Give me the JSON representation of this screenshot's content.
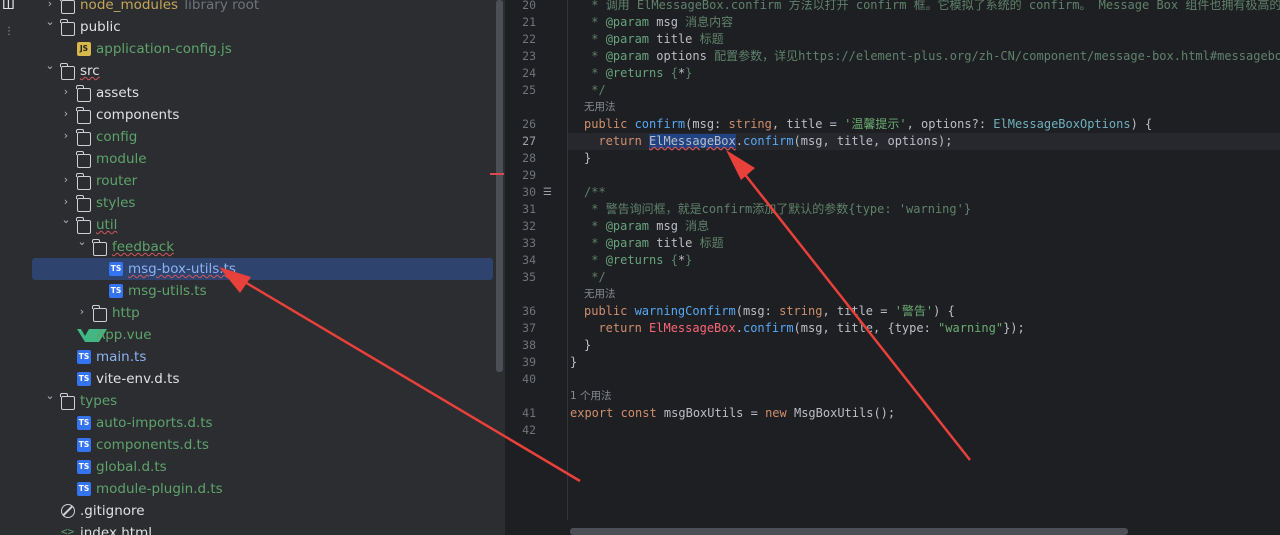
{
  "tree": [
    {
      "label": "node_modules",
      "extra": "library root",
      "kind": "folder",
      "depth": 0,
      "expanded": false,
      "style": "olive"
    },
    {
      "label": "public",
      "kind": "folder",
      "depth": 0,
      "expanded": true,
      "style": "normal"
    },
    {
      "label": "application-config.js",
      "kind": "js",
      "depth": 1,
      "style": "green"
    },
    {
      "label": "src",
      "kind": "folder",
      "depth": 0,
      "expanded": true,
      "style": "normal",
      "wavy": true
    },
    {
      "label": "assets",
      "kind": "folder",
      "depth": 1,
      "expanded": false,
      "style": "normal"
    },
    {
      "label": "components",
      "kind": "folder",
      "depth": 1,
      "expanded": false,
      "style": "normal"
    },
    {
      "label": "config",
      "kind": "folder",
      "depth": 1,
      "expanded": false,
      "style": "green"
    },
    {
      "label": "module",
      "kind": "folder",
      "depth": 1,
      "style": "green"
    },
    {
      "label": "router",
      "kind": "folder",
      "depth": 1,
      "expanded": false,
      "style": "green"
    },
    {
      "label": "styles",
      "kind": "folder",
      "depth": 1,
      "expanded": false,
      "style": "green"
    },
    {
      "label": "util",
      "kind": "folder",
      "depth": 1,
      "expanded": true,
      "style": "green",
      "wavy": true
    },
    {
      "label": "feedback",
      "kind": "folder",
      "depth": 2,
      "expanded": true,
      "style": "green",
      "wavy": true
    },
    {
      "label": "msg-box-utils.ts",
      "kind": "ts",
      "depth": 3,
      "style": "blue",
      "selected": true,
      "wavy": true
    },
    {
      "label": "msg-utils.ts",
      "kind": "ts",
      "depth": 3,
      "style": "green"
    },
    {
      "label": "http",
      "kind": "folder",
      "depth": 2,
      "expanded": false,
      "style": "green"
    },
    {
      "label": "App.vue",
      "kind": "vue",
      "depth": 1,
      "style": "green"
    },
    {
      "label": "main.ts",
      "kind": "ts",
      "depth": 1,
      "style": "blue"
    },
    {
      "label": "vite-env.d.ts",
      "kind": "ts",
      "depth": 1,
      "style": "normal"
    },
    {
      "label": "types",
      "kind": "folder",
      "depth": 0,
      "expanded": true,
      "style": "green"
    },
    {
      "label": "auto-imports.d.ts",
      "kind": "ts",
      "depth": 1,
      "style": "green"
    },
    {
      "label": "components.d.ts",
      "kind": "ts",
      "depth": 1,
      "style": "green"
    },
    {
      "label": "global.d.ts",
      "kind": "ts",
      "depth": 1,
      "style": "green"
    },
    {
      "label": "module-plugin.d.ts",
      "kind": "ts",
      "depth": 1,
      "style": "green"
    },
    {
      "label": ".gitignore",
      "kind": "git",
      "depth": 0,
      "style": "normal"
    },
    {
      "label": "index.html",
      "kind": "html",
      "depth": 0,
      "style": "normal"
    }
  ],
  "editor": {
    "line_numbers": [
      "20",
      "21",
      "22",
      "23",
      "24",
      "25",
      "26",
      "27",
      "28",
      "29",
      "30",
      "31",
      "32",
      "33",
      "34",
      "35",
      "36",
      "37",
      "38",
      "39",
      "40",
      "41",
      "42"
    ],
    "active_line": "27",
    "hints": {
      "no_usage": "无用法",
      "one_usage": "1 个用法"
    },
    "lines": {
      "l20": [
        [
          "cm",
          " * 调用 ElMessageBox.confirm 方法以打开 confirm 框。它模拟了系统的 confirm。 Message Box 组件也拥有极高的定"
        ]
      ],
      "l21": [
        [
          "cm",
          " * "
        ],
        [
          "tag",
          "@param"
        ],
        [
          "cls",
          " msg"
        ],
        [
          "cm",
          " 消息内容"
        ]
      ],
      "l22": [
        [
          "cm",
          " * "
        ],
        [
          "tag",
          "@param"
        ],
        [
          "cls",
          " title"
        ],
        [
          "cm",
          " 标题"
        ]
      ],
      "l23": [
        [
          "cm",
          " * "
        ],
        [
          "tag",
          "@param"
        ],
        [
          "cls",
          " options"
        ],
        [
          "cm",
          " 配置参数，详见https://element-plus.org/zh-CN/component/message-box.html#messagebox-宏"
        ]
      ],
      "l24": [
        [
          "cm",
          " * "
        ],
        [
          "tag",
          "@returns"
        ],
        [
          "cm",
          " {"
        ],
        [
          "cls",
          "*"
        ],
        [
          "cm",
          "}"
        ]
      ],
      "l25": [
        [
          "cm",
          " */"
        ]
      ],
      "l26": [
        [
          "kw",
          "public "
        ],
        [
          "fn",
          "confirm"
        ],
        [
          "cls",
          "(msg: "
        ],
        [
          "kw",
          "string"
        ],
        [
          "cls",
          ", title = "
        ],
        [
          "str",
          "'温馨提示'"
        ],
        [
          "cls",
          ", options?: "
        ],
        [
          "ty",
          "ElMessageBoxOptions"
        ],
        [
          "cls",
          ") {"
        ]
      ],
      "l27": [
        [
          "kw",
          "  return "
        ],
        [
          "hl",
          "ElMessageBox"
        ],
        [
          "cls",
          "."
        ],
        [
          "fn",
          "confirm"
        ],
        [
          "cls",
          "(msg, title, options);"
        ]
      ],
      "l28": [
        [
          "cls",
          "}"
        ]
      ],
      "l29": [
        [
          "cls",
          ""
        ]
      ],
      "l30": [
        [
          "cm",
          "/**"
        ]
      ],
      "l31": [
        [
          "cm",
          " * 警告询问框，就是confirm添加了默认的参数{type: 'warning'}"
        ]
      ],
      "l32": [
        [
          "cm",
          " * "
        ],
        [
          "tag",
          "@param"
        ],
        [
          "cls",
          " msg"
        ],
        [
          "cm",
          " 消息"
        ]
      ],
      "l33": [
        [
          "cm",
          " * "
        ],
        [
          "tag",
          "@param"
        ],
        [
          "cls",
          " title"
        ],
        [
          "cm",
          " 标题"
        ]
      ],
      "l34": [
        [
          "cm",
          " * "
        ],
        [
          "tag",
          "@returns"
        ],
        [
          "cm",
          " {"
        ],
        [
          "cls",
          "*"
        ],
        [
          "cm",
          "}"
        ]
      ],
      "l35": [
        [
          "cm",
          " */"
        ]
      ],
      "l36": [
        [
          "kw",
          "public "
        ],
        [
          "fn",
          "warningConfirm"
        ],
        [
          "cls",
          "(msg: "
        ],
        [
          "kw",
          "string"
        ],
        [
          "cls",
          ", title = "
        ],
        [
          "str",
          "'警告'"
        ],
        [
          "cls",
          ") {"
        ]
      ],
      "l37": [
        [
          "kw",
          "  return "
        ],
        [
          "err",
          "ElMessageBox"
        ],
        [
          "cls",
          "."
        ],
        [
          "fn",
          "confirm"
        ],
        [
          "cls",
          "(msg, title, {type: "
        ],
        [
          "str",
          "\"warning\""
        ],
        [
          "cls",
          "});"
        ]
      ],
      "l38": [
        [
          "cls",
          "}"
        ]
      ],
      "l39": [
        [
          "cls",
          "}"
        ]
      ],
      "l40": [
        [
          "cls",
          ""
        ]
      ],
      "l41": [
        [
          "kw",
          "export const "
        ],
        [
          "cls",
          "msgBoxUtils = "
        ],
        [
          "kw",
          "new "
        ],
        [
          "cls",
          "MsgBoxUtils();"
        ]
      ],
      "l42": [
        [
          "cls",
          ""
        ]
      ]
    }
  },
  "colors": {
    "arrow": "#e8403a",
    "panel_bg": "#2b2d30",
    "editor_bg": "#1e1f22",
    "selection": "#2e436e"
  }
}
